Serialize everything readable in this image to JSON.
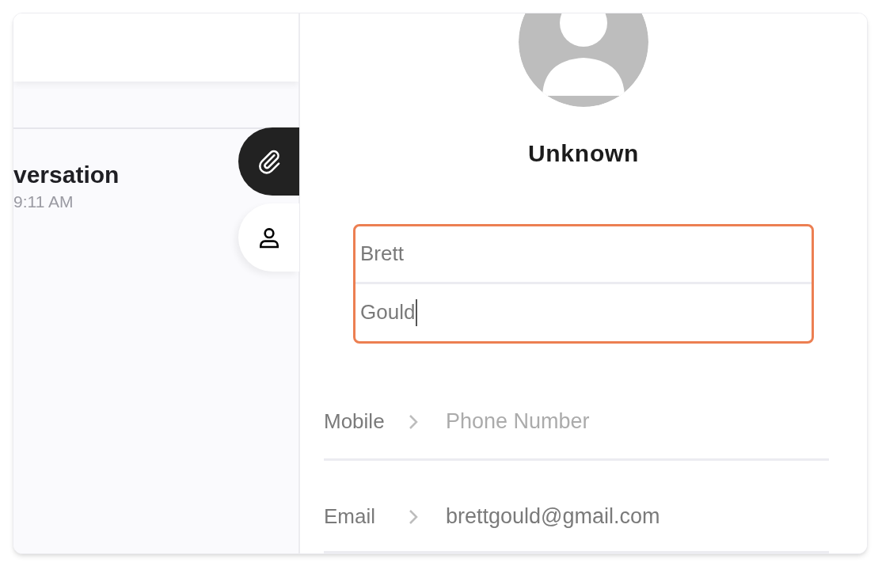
{
  "conversation": {
    "title": "versation",
    "time": "9:11 AM"
  },
  "side_tabs": [
    {
      "kind": "attachment",
      "selected": false
    },
    {
      "kind": "contact",
      "selected": true
    }
  ],
  "contact": {
    "name": "Unknown",
    "name_fields": [
      {
        "value": "Brett",
        "focused": false
      },
      {
        "value": "Gould",
        "focused": true
      }
    ],
    "highlighted": true,
    "details": [
      {
        "label": "Mobile",
        "placeholder": "Phone Number"
      },
      {
        "label": "Email",
        "value": "brettgould@gmail.com"
      }
    ]
  }
}
